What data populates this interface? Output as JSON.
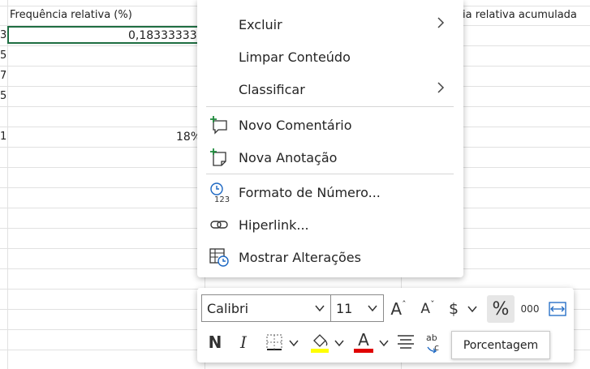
{
  "sheet": {
    "header_left": "Frequência relativa (%)",
    "header_right": "ia relativa acumulada",
    "selected_value": "0,183333333",
    "row_value": "18%",
    "row_edge_digits": [
      "3",
      "5",
      "7",
      "5",
      "1"
    ]
  },
  "context_menu": {
    "items": [
      {
        "label": "Excluir",
        "icon": "none",
        "submenu": true
      },
      {
        "label": "Limpar Conteúdo",
        "icon": "none",
        "submenu": false
      },
      {
        "label": "Classificar",
        "icon": "none",
        "submenu": true
      },
      {
        "label": "Novo Comentário",
        "icon": "new-comment-icon",
        "submenu": false
      },
      {
        "label": "Nova Anotação",
        "icon": "new-note-icon",
        "submenu": false
      },
      {
        "label": "Formato de Número...",
        "icon": "number-format-icon",
        "submenu": false
      },
      {
        "label": "Hiperlink...",
        "icon": "hyperlink-icon",
        "submenu": false
      },
      {
        "label": "Mostrar Alterações",
        "icon": "show-changes-icon",
        "submenu": false
      }
    ]
  },
  "mini_toolbar": {
    "font_name": "Calibri",
    "font_size": "11",
    "grow_font_label": "A",
    "shrink_font_label": "A",
    "currency_label": "$",
    "percent_label": "%",
    "comma_label": "000",
    "bold_label": "N",
    "italic_label": "I",
    "font_color_label": "A",
    "highlight_color": "#ffff00",
    "font_color": "#e00000",
    "accent_color": "#1e6e42"
  },
  "tooltip": {
    "text": "Porcentagem"
  }
}
